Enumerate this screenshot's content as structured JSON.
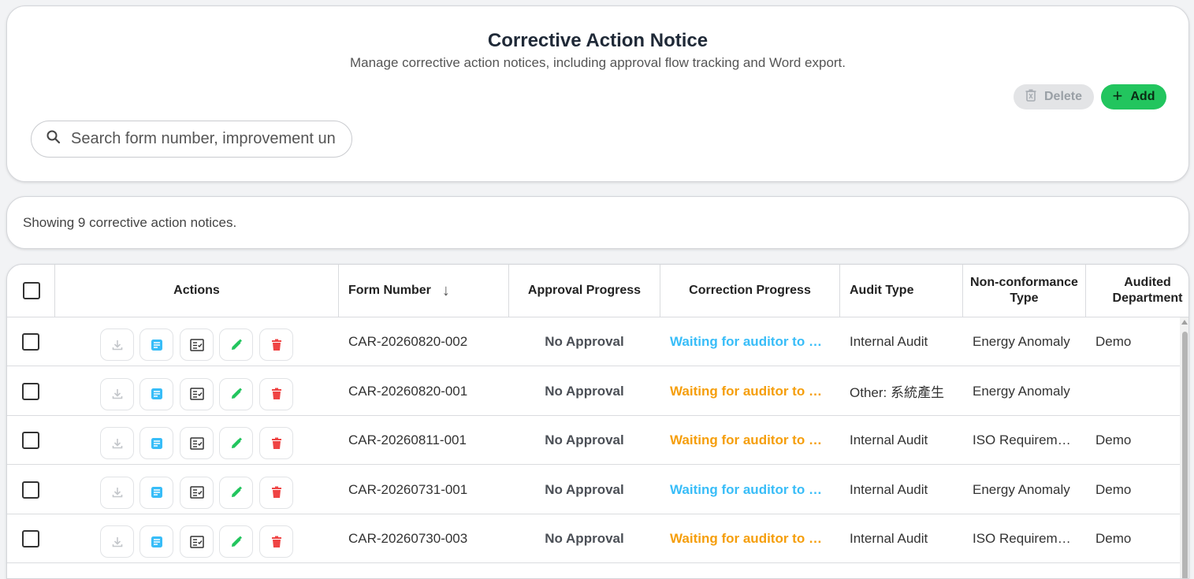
{
  "header": {
    "title": "Corrective Action Notice",
    "subtitle": "Manage corrective action notices, including approval flow tracking and Word export.",
    "delete_label": "Delete",
    "add_label": "Add",
    "add_icon": "+",
    "search_placeholder": "Search form number, improvement un"
  },
  "summary": {
    "text": "Showing 9 corrective action notices."
  },
  "table": {
    "columns": {
      "actions": "Actions",
      "form_number": "Form Number",
      "sort_icon": "↓",
      "approval": "Approval Progress",
      "correction": "Correction Progress",
      "audit_type": "Audit Type",
      "nonconformance": "Non-conformance Type",
      "department": "Audited Department"
    },
    "rows": [
      {
        "form_number": "CAR-20260820-002",
        "approval": "No Approval",
        "correction": "Waiting for auditor to …",
        "correction_color": "blue",
        "audit_type": "Internal Audit",
        "nonconformance": "Energy Anomaly",
        "department": "Demo"
      },
      {
        "form_number": "CAR-20260820-001",
        "approval": "No Approval",
        "correction": "Waiting for auditor to …",
        "correction_color": "orange",
        "audit_type": "Other: 系統產生",
        "nonconformance": "Energy Anomaly",
        "department": ""
      },
      {
        "form_number": "CAR-20260811-001",
        "approval": "No Approval",
        "correction": "Waiting for auditor to …",
        "correction_color": "orange",
        "audit_type": "Internal Audit",
        "nonconformance": "ISO Requirem…",
        "department": "Demo"
      },
      {
        "form_number": "CAR-20260731-001",
        "approval": "No Approval",
        "correction": "Waiting for auditor to …",
        "correction_color": "blue",
        "audit_type": "Internal Audit",
        "nonconformance": "Energy Anomaly",
        "department": "Demo"
      },
      {
        "form_number": "CAR-20260730-003",
        "approval": "No Approval",
        "correction": "Waiting for auditor to …",
        "correction_color": "orange",
        "audit_type": "Internal Audit",
        "nonconformance": "ISO Requirem…",
        "department": "Demo"
      }
    ]
  },
  "colors": {
    "accent_green": "#22c55e",
    "blue_status": "#38bdf8",
    "orange_status": "#f59e0b",
    "delete_red": "#ef4444",
    "doc_blue": "#38bdf8"
  },
  "row_action_icons": [
    "download-icon",
    "document-icon",
    "checklist-icon",
    "edit-pencil-icon",
    "trash-icon"
  ]
}
